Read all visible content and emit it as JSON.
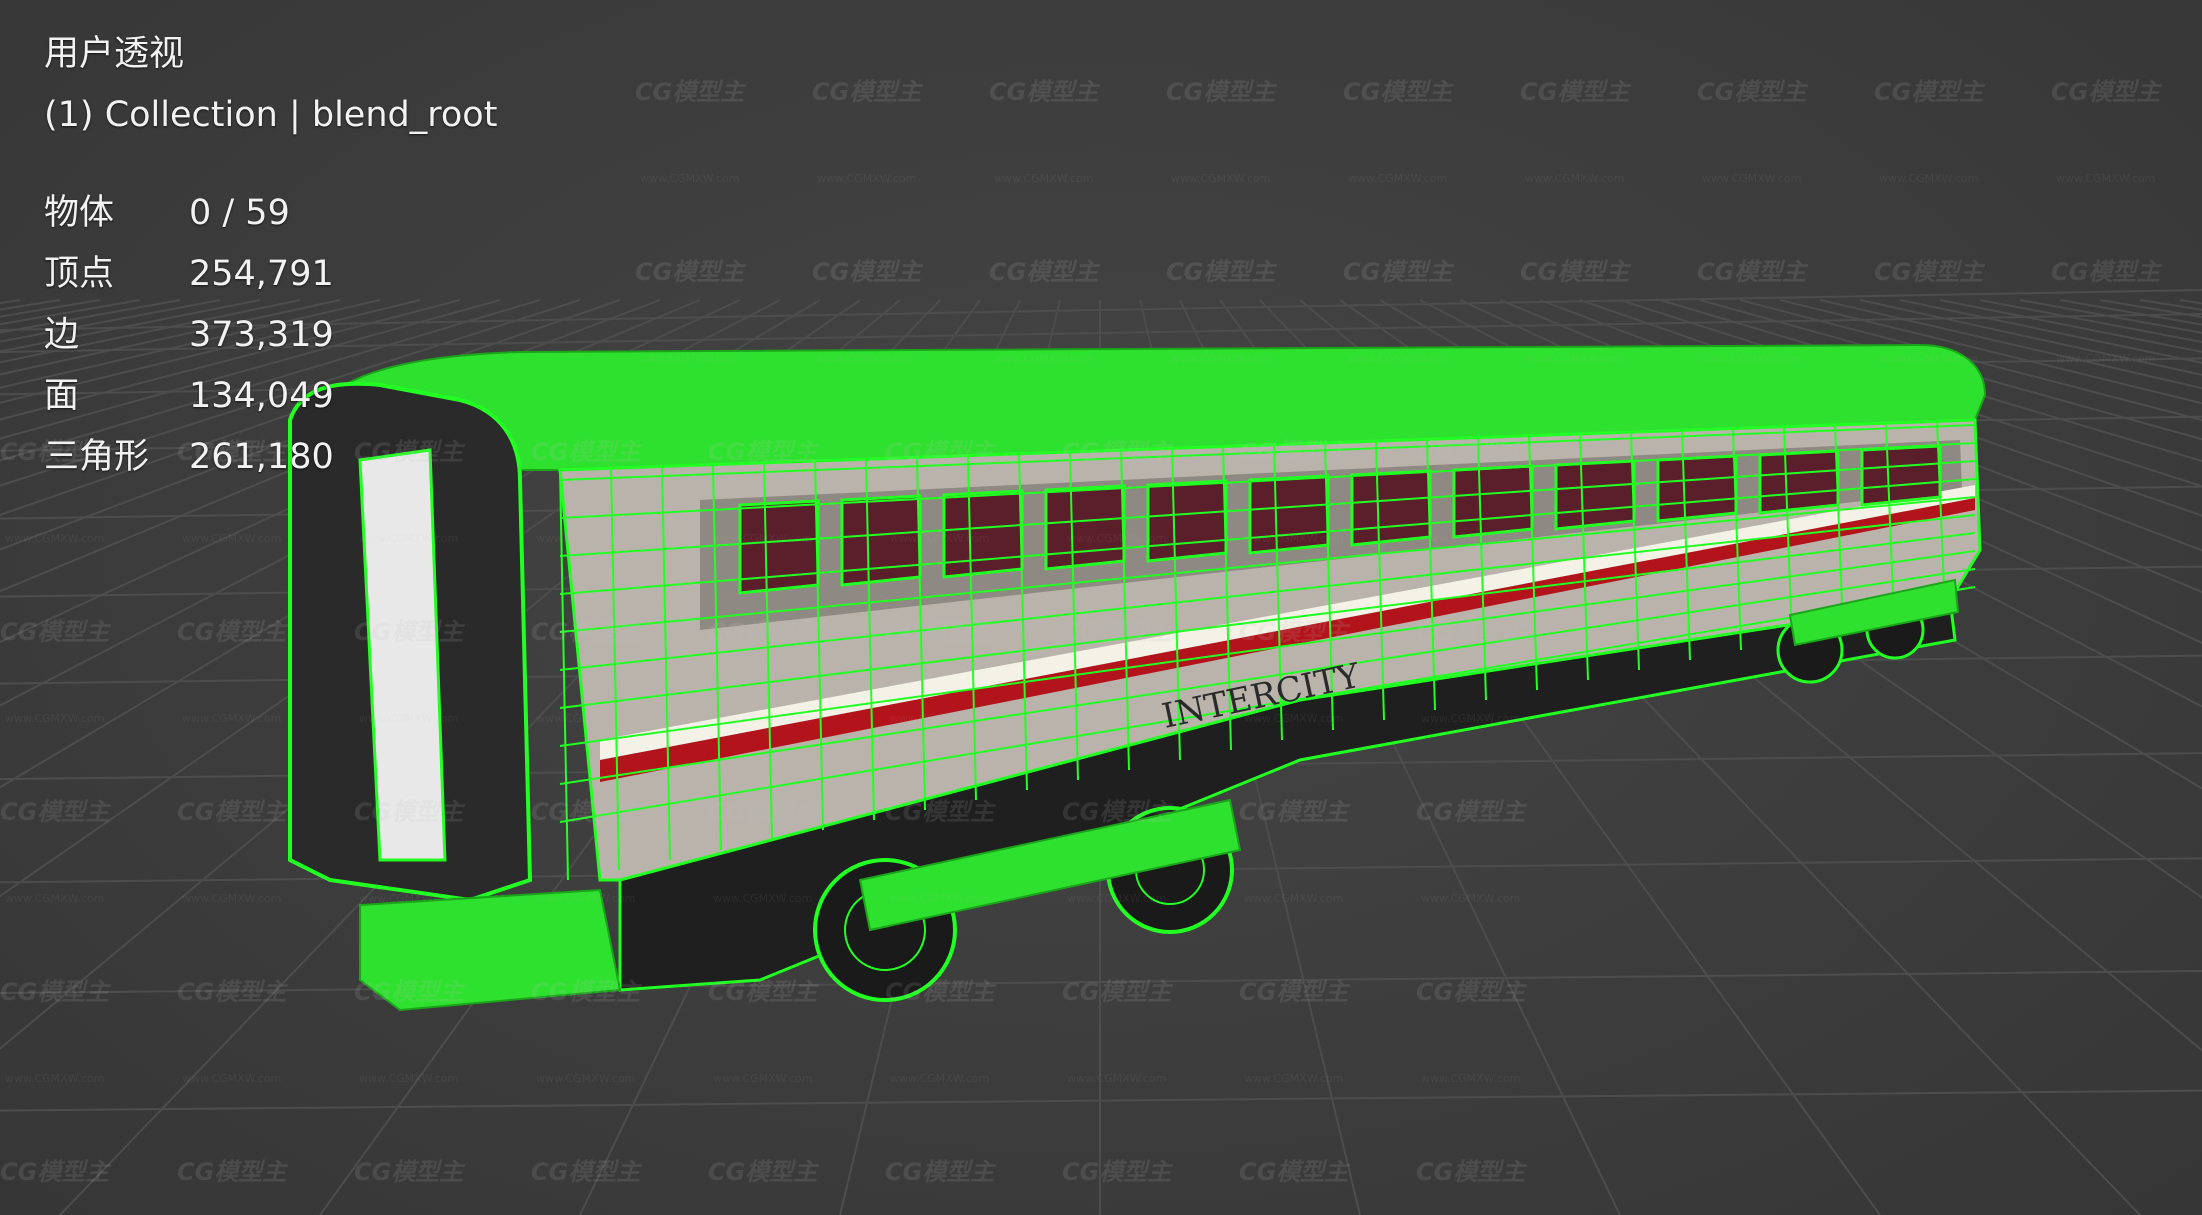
{
  "viewport": {
    "view_name": "用户透视",
    "collection_line": "(1) Collection | blend_root"
  },
  "stats": [
    {
      "label": "物体",
      "value": "0 / 59"
    },
    {
      "label": "顶点",
      "value": "254,791"
    },
    {
      "label": "边",
      "value": "373,319"
    },
    {
      "label": "面",
      "value": "134,049"
    },
    {
      "label": "三角形",
      "value": "261,180"
    }
  ],
  "model": {
    "livery_text": "INTERCITY",
    "wireframe_color": "#22ff22",
    "body_color": "#b9b3ab",
    "stripe_red": "#b3131b",
    "stripe_white": "#f4f1e6"
  },
  "watermark": {
    "brand": "CG模型主",
    "url": "www.CGMXW.com"
  },
  "colors": {
    "background": "#3d3d3d",
    "grid": "#4d4d4d",
    "text": "#f2f2f2"
  }
}
